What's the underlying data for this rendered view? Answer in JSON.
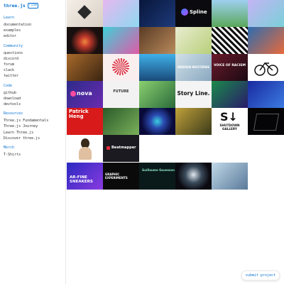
{
  "sidebar": {
    "logo": "three.js",
    "version": "r150",
    "sections": [
      {
        "title": "Learn",
        "links": [
          "documentation",
          "examples",
          "editor"
        ]
      },
      {
        "title": "Community",
        "links": [
          "questions",
          "discord",
          "forum",
          "slack",
          "twitter"
        ]
      },
      {
        "title": "Code",
        "links": [
          "github",
          "download",
          "devtools"
        ]
      },
      {
        "title": "Resources",
        "links": [
          "Three.js Fundamentals",
          "Three.js Journey",
          "Learn Three.js",
          "Discover three.js"
        ]
      },
      {
        "title": "Merch",
        "links": [
          "T-Shirts"
        ]
      }
    ]
  },
  "tiles": {
    "spline": "Spline",
    "future": "FUTURE",
    "story": "Story Line.",
    "patrick": "Patrick Heng",
    "nova": "nova",
    "beatmapper": "Beatmapper",
    "shutdown": "SHUTDOWN GALLERY",
    "sneakers": "AR-FINE SNEAKERS",
    "experiments": "GRAPHIC EXPERIMENTS",
    "guillaume": "Guillaume Gouessan",
    "voice": "VOICE OF RACISM",
    "westerns": "WEEDEN WESTERNS"
  },
  "footer": {
    "submit": "submit project"
  }
}
